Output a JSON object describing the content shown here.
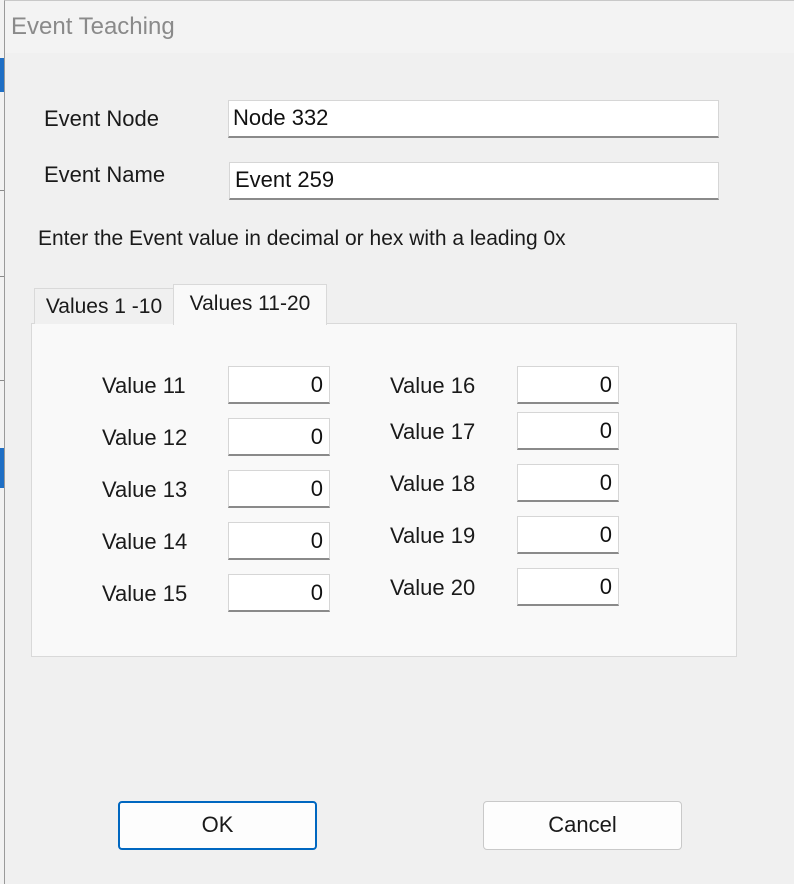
{
  "window": {
    "title": "Event Teaching"
  },
  "event_node": {
    "label": "Event Node",
    "value": "Node 332"
  },
  "event_name": {
    "label": "Event Name",
    "value": "Event 259"
  },
  "instruction": "Enter the Event value in decimal or hex with a leading 0x",
  "tabs": [
    {
      "label": "Values 1 -10",
      "active": false
    },
    {
      "label": "Values 11-20",
      "active": true
    }
  ],
  "values_left": [
    {
      "label": "Value 11",
      "value": "0"
    },
    {
      "label": "Value 12",
      "value": "0"
    },
    {
      "label": "Value 13",
      "value": "0"
    },
    {
      "label": "Value 14",
      "value": "0"
    },
    {
      "label": "Value 15",
      "value": "0"
    }
  ],
  "values_right": [
    {
      "label": "Value 16",
      "value": "0"
    },
    {
      "label": "Value 17",
      "value": "0"
    },
    {
      "label": "Value 18",
      "value": "0"
    },
    {
      "label": "Value 19",
      "value": "0"
    },
    {
      "label": "Value 20",
      "value": "0"
    }
  ],
  "buttons": {
    "ok": "OK",
    "cancel": "Cancel"
  },
  "colors": {
    "default_button_border": "#0067c0",
    "background_app_accent": "#1f6fc5"
  }
}
